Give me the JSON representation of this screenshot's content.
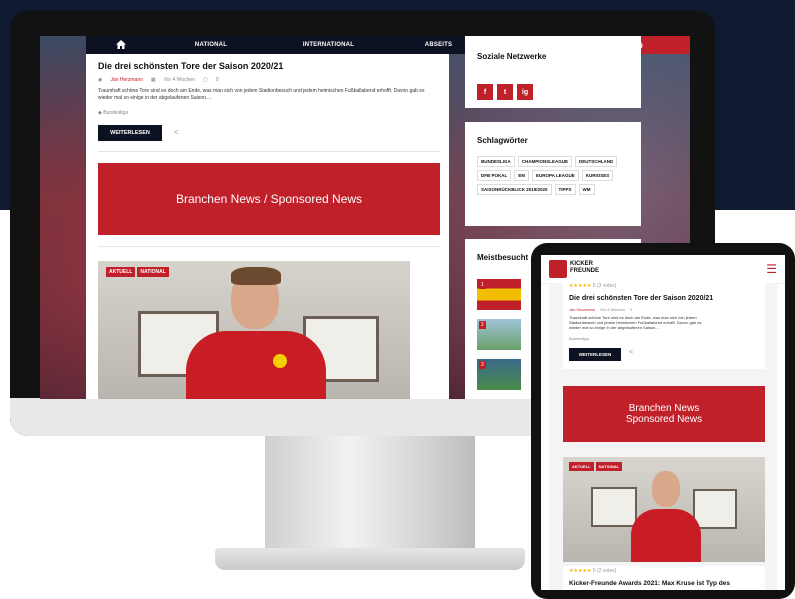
{
  "nav": {
    "home_icon": "home-icon",
    "items": [
      "NATIONAL",
      "INTERNATIONAL",
      "ABSEITS"
    ],
    "search_icon": "search-icon",
    "globe_icon": "globe-icon"
  },
  "post": {
    "title": "Die drei schönsten Tore der Saison 2020/21",
    "author": "Jan Herzmann",
    "date": "Vor 4 Wochen",
    "comments": "0",
    "excerpt": "Traumhaft schöne Tore sind es doch am Ende, was man sich von jedem Stadionbesuch und jedem heimischen Fußballabend erhofft. Davon gab es wieder mal so einige in der abgelaufenen Saison....",
    "tag": "Bundesliga",
    "read_more": "WEITERLESEN"
  },
  "sponsored": "Branchen News / Sponsored News",
  "article_badges": [
    "AKTUELL",
    "NATIONAL"
  ],
  "sidebar": {
    "social_title": "Soziale Netzwerke",
    "social_icons": [
      "f",
      "t",
      "ig"
    ],
    "tags_title": "Schlagwörter",
    "tags": [
      "BUNDESLIGA",
      "CHAMPIONSLEAGUE",
      "DEUTSCHLAND",
      "DFB POKAL",
      "EM",
      "EUROPA LEAGUE",
      "KURIOSES",
      "SAISONRÜCKBLICK 2019/2020",
      "TIPPS",
      "WM"
    ],
    "most_title": "Meistbesucht",
    "most_numbers": [
      "1",
      "2",
      "3"
    ]
  },
  "tablet": {
    "logo_line1": "KICKER",
    "logo_line2": "FREUNDE",
    "rating_text": "5 (3 votes)",
    "post_title": "Die drei schönsten Tore der Saison 2020/21",
    "author": "Jan Herzmann",
    "date": "Vor 4 Wochen",
    "comments": "0",
    "excerpt": "Traumhaft schöne Tore sind es doch am Ende, was man sich von jedem Stadionbesuch und jedem heimischen Fußballabend erhofft. Davon gab es wieder mal so einige in der abgelaufenen Saison....",
    "tag": "Bundesliga",
    "read_more": "WEITERLESEN",
    "sponsored_line1": "Branchen News",
    "sponsored_line2": "Sponsored News",
    "badges": [
      "AKTUELL",
      "NATIONAL"
    ],
    "rating_text2": "5 (2 votes)",
    "next_title": "Kicker-Freunde Awards 2021: Max Kruse ist Typ des"
  },
  "colors": {
    "accent": "#c0202a",
    "navy": "#0c1222"
  }
}
